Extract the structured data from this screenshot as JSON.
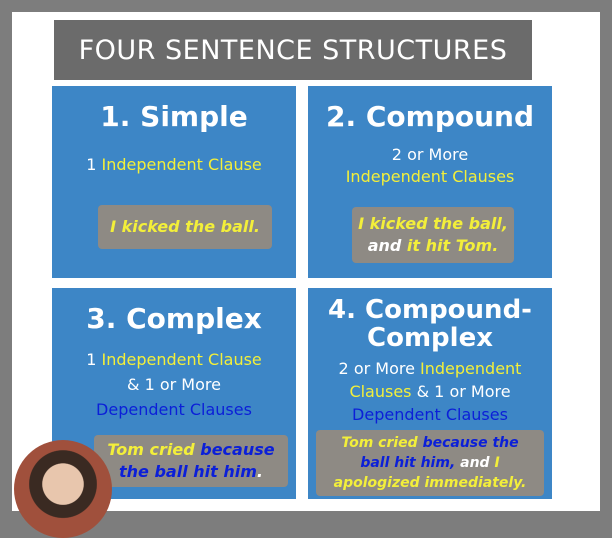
{
  "title": "FOUR SENTENCE STRUCTURES",
  "simple": {
    "heading": "1. Simple",
    "desc_a": "1",
    "desc_b": "Independent Clause",
    "example": "I kicked the ball."
  },
  "compound": {
    "heading": "2. Compound",
    "desc_a": "2 or More",
    "desc_b": "Independent Clauses",
    "ex_a": "I kicked the ball,",
    "ex_b": "and",
    "ex_c": "it hit Tom."
  },
  "complex": {
    "heading": "3. Complex",
    "desc_a": "1",
    "desc_b": "Independent Clause",
    "desc_c": "& 1 or More",
    "desc_d": "Dependent Clauses",
    "ex_a": "Tom cried",
    "ex_b": "because",
    "ex_c": "the ball hit him"
  },
  "compound_complex": {
    "heading_a": "4. Compound-",
    "heading_b": "Complex",
    "desc_a": "2 or More",
    "desc_b": "Independent",
    "desc_c": "Clauses",
    "desc_d": "& 1 or More",
    "desc_e": "Dependent Clauses",
    "ex_a": "Tom cried",
    "ex_b": "because the",
    "ex_c": "ball hit him,",
    "ex_d": "and",
    "ex_e": "I",
    "ex_f": "apologized immediately."
  }
}
